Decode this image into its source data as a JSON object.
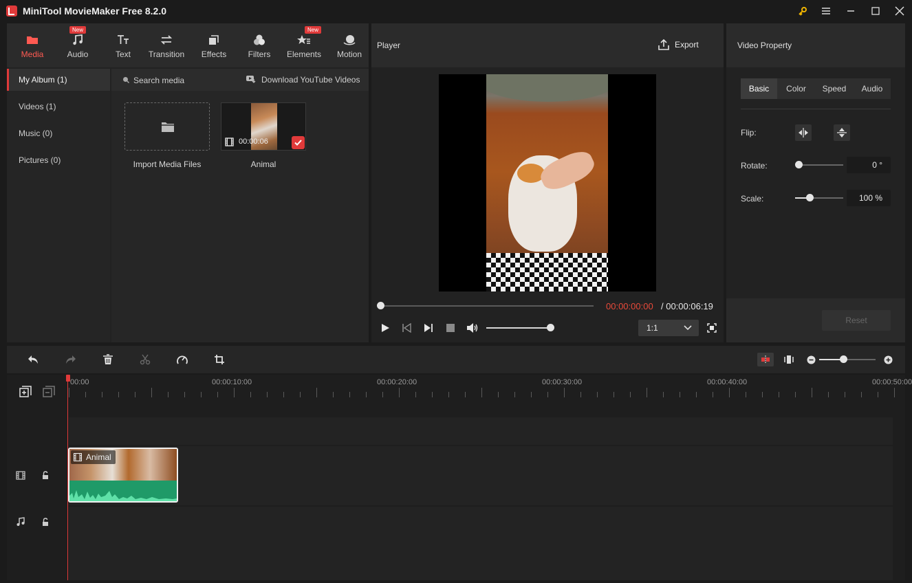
{
  "app": {
    "title": "MiniTool MovieMaker Free 8.2.0"
  },
  "tabs": [
    {
      "label": "Media",
      "badge": ""
    },
    {
      "label": "Audio",
      "badge": "New"
    },
    {
      "label": "Text",
      "badge": ""
    },
    {
      "label": "Transition",
      "badge": ""
    },
    {
      "label": "Effects",
      "badge": ""
    },
    {
      "label": "Filters",
      "badge": ""
    },
    {
      "label": "Elements",
      "badge": "New"
    },
    {
      "label": "Motion",
      "badge": ""
    }
  ],
  "album": {
    "items": [
      "My Album (1)",
      "Videos (1)",
      "Music (0)",
      "Pictures (0)"
    ]
  },
  "media": {
    "search_label": "Search media",
    "download_label": "Download YouTube Videos",
    "import_label": "Import Media Files",
    "clip_name": "Animal",
    "clip_duration": "00:00:06"
  },
  "player": {
    "title": "Player",
    "export_label": "Export",
    "current_time": "00:00:00:00",
    "total_time": "/ 00:00:06:19",
    "ratio": "1:1",
    "progress": 0,
    "volume": 1
  },
  "property": {
    "title": "Video Property",
    "tabs": [
      "Basic",
      "Color",
      "Speed",
      "Audio"
    ],
    "flip_label": "Flip:",
    "rotate_label": "Rotate:",
    "rotate_value": "0 °",
    "scale_label": "Scale:",
    "scale_value": "100 %",
    "reset_label": "Reset"
  },
  "timeline": {
    "ruler": [
      "00:00",
      "00:00:10:00",
      "00:00:20:00",
      "00:00:30:00",
      "00:00:40:00",
      "00:00:50:00"
    ],
    "clip_name": "Animal"
  },
  "colors": {
    "accent": "#e03a3a",
    "audio_wave": "#2aa876"
  }
}
